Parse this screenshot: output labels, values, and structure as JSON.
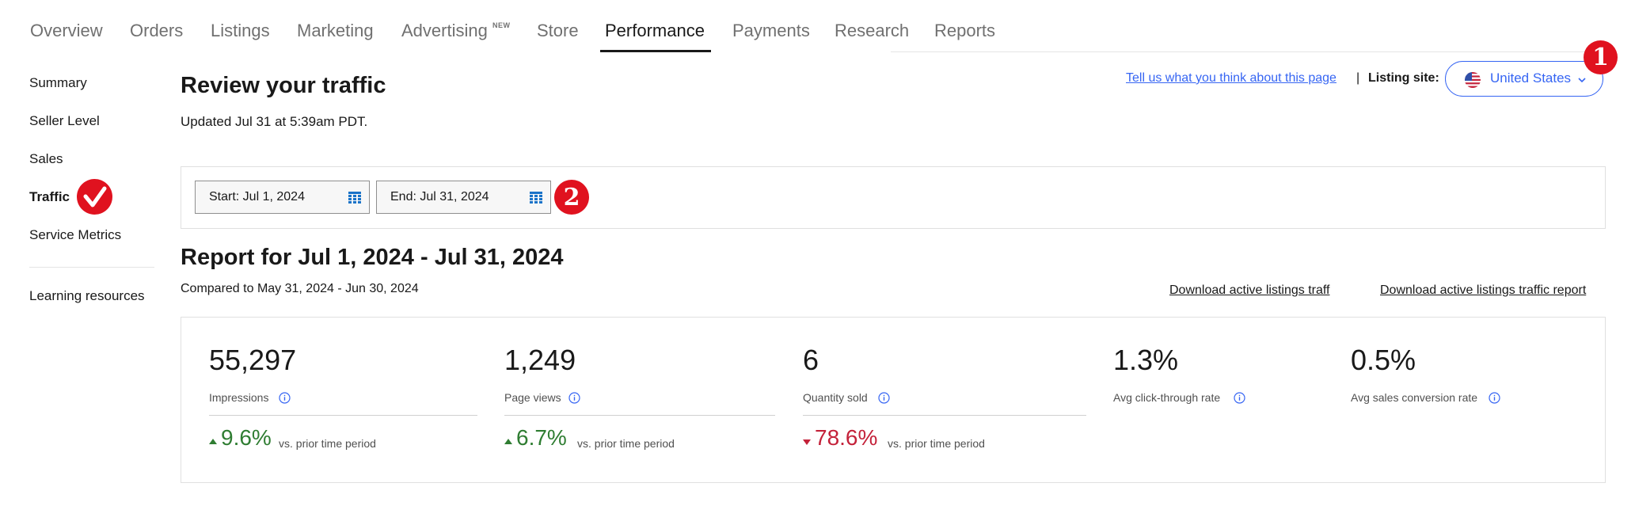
{
  "nav": {
    "tabs": [
      {
        "label": "Overview"
      },
      {
        "label": "Orders"
      },
      {
        "label": "Listings"
      },
      {
        "label": "Marketing"
      },
      {
        "label": "Advertising",
        "badge": "NEW"
      },
      {
        "label": "Store"
      },
      {
        "label": "Performance",
        "active": true
      },
      {
        "label": "Payments"
      },
      {
        "label": "Research"
      },
      {
        "label": "Reports"
      }
    ]
  },
  "sidebar": {
    "items": [
      {
        "label": "Summary"
      },
      {
        "label": "Seller Level"
      },
      {
        "label": "Sales"
      },
      {
        "label": "Traffic",
        "active": true
      },
      {
        "label": "Service Metrics"
      },
      {
        "label": "Learning resources"
      }
    ]
  },
  "annotations": {
    "badge1": "1",
    "badge2": "2"
  },
  "header": {
    "title": "Review your traffic",
    "updated": "Updated Jul 31 at 5:39am PDT.",
    "feedback_link": "Tell us what you think about this page",
    "separator": "|",
    "listing_site_label": "Listing site:",
    "listing_site_value": "United States"
  },
  "date_range": {
    "start": "Start: Jul 1, 2024",
    "end": "End: Jul 31, 2024"
  },
  "report": {
    "title": "Report for Jul 1, 2024 - Jul 31, 2024",
    "compared": "Compared to May 31, 2024 - Jun 30, 2024",
    "download_link_1": "Download active listings traff",
    "download_link_2": "Download active listings traffic report"
  },
  "metrics": [
    {
      "value": "55,297",
      "label": "Impressions",
      "change": "9.6%",
      "direction": "up",
      "vs": "vs. prior time period"
    },
    {
      "value": "1,249",
      "label": "Page views",
      "change": "6.7%",
      "direction": "up",
      "vs": "vs. prior time period"
    },
    {
      "value": "6",
      "label": "Quantity sold",
      "change": "78.6%",
      "direction": "down",
      "vs": "vs. prior time period"
    },
    {
      "value": "1.3%",
      "label": "Avg click-through rate"
    },
    {
      "value": "0.5%",
      "label": "Avg sales conversion rate"
    }
  ],
  "colors": {
    "link_blue": "#3665f3",
    "positive_green": "#2f7d32",
    "negative_red": "#c4223a",
    "annotation_red": "#e0121f"
  }
}
